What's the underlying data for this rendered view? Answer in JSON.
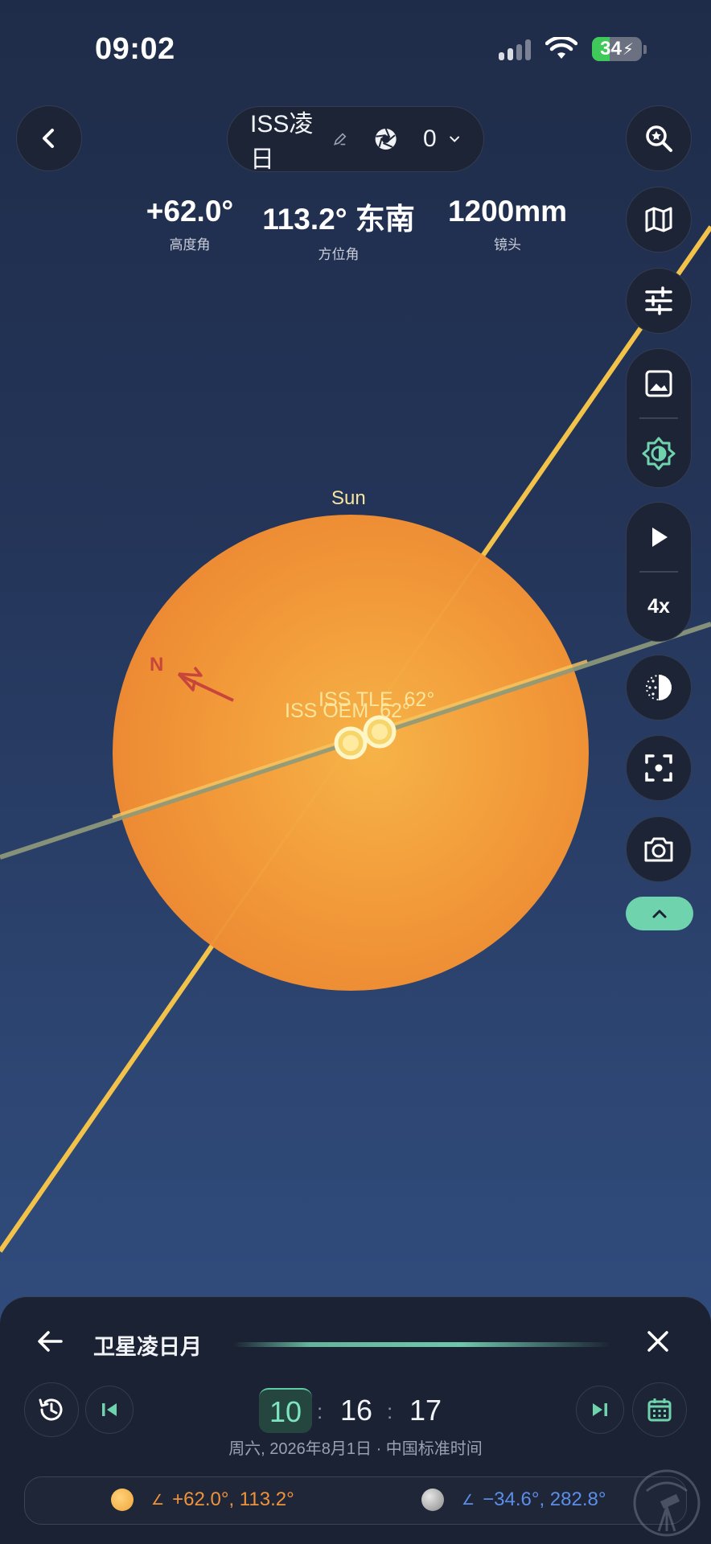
{
  "status_bar": {
    "time": "09:02",
    "battery": "34"
  },
  "header": {
    "title": "ISS凌日",
    "counter_value": "0"
  },
  "readouts": [
    {
      "value": "+62.0°",
      "label": "高度角"
    },
    {
      "value": "113.2° 东南",
      "label": "方位角"
    },
    {
      "value": "1200mm",
      "label": "镜头"
    }
  ],
  "canvas": {
    "sun_label": "Sun",
    "north_label": "N",
    "iss_tle_label": "ISS TLE  62°",
    "iss_oem_label": "ISS OEM  62°"
  },
  "side_tools": {
    "speed_label": "4x"
  },
  "panel": {
    "title": "卫星凌日月",
    "hour": "10",
    "minute": "16",
    "second": "17",
    "separator": ":",
    "date_text": "周六, 2026年8月1日 · 中国标准时间",
    "sun_coord": "+62.0°, 113.2°",
    "moon_coord": "−34.6°, 282.8°",
    "angle_glyph": "∠"
  },
  "colors": {
    "sun": "#f29437",
    "track": "#f3c24a",
    "accent": "#6fd3ad",
    "sun_coord_text": "#f0923a",
    "moon_coord_text": "#5c8ee8"
  }
}
